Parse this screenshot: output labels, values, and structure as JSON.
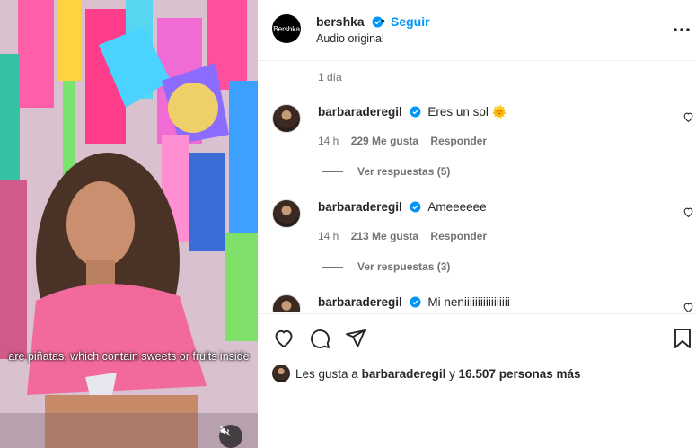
{
  "media": {
    "subtitle": "are piñatas, which contain sweets or fruits inside"
  },
  "header": {
    "brand_avatar_text": "Bershka",
    "username": "bershka",
    "separator": "•",
    "follow_label": "Seguir",
    "audio_label": "Audio original"
  },
  "post": {
    "time_ago": "1 día"
  },
  "comments": [
    {
      "user": "barbaraderegil",
      "text": "Eres un sol 🌞",
      "time": "14 h",
      "likes": "229 Me gusta",
      "reply_label": "Responder",
      "view_replies": "Ver respuestas (5)"
    },
    {
      "user": "barbaraderegil",
      "text": "Ameeeeee",
      "time": "14 h",
      "likes": "213 Me gusta",
      "reply_label": "Responder",
      "view_replies": "Ver respuestas (3)"
    },
    {
      "user": "barbaraderegil",
      "text": "Mi neniiiiiiiiiiiiiiiii"
    }
  ],
  "likes_summary": {
    "prefix": "Les gusta a",
    "user": "barbaraderegil",
    "conjunction": "y",
    "others": "16.507 personas más"
  },
  "colors": {
    "accent": "#0095f6",
    "verified": "#0095f6",
    "text": "#262626",
    "secondary": "#737373"
  },
  "icons": {
    "verified": "verified-badge-icon",
    "more": "more-options-icon",
    "heart": "heart-icon",
    "comment": "comment-icon",
    "share": "share-icon",
    "save": "bookmark-icon",
    "mute": "muted-speaker-icon"
  }
}
